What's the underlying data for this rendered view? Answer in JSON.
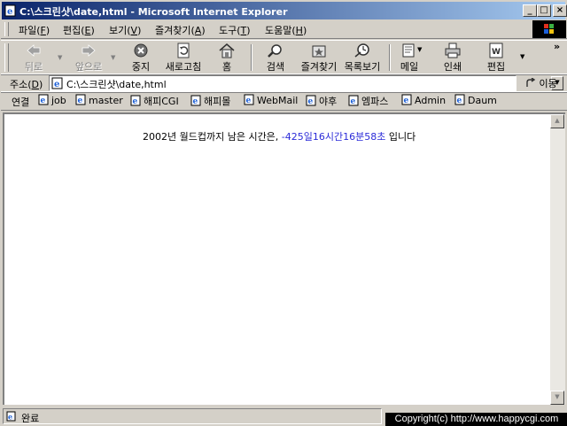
{
  "window": {
    "title": "C:\\스크린샷\\date,html - Microsoft Internet Explorer"
  },
  "menu": [
    {
      "label": "파일(",
      "key": "F",
      "end": ")"
    },
    {
      "label": "편집(",
      "key": "E",
      "end": ")"
    },
    {
      "label": "보기(",
      "key": "V",
      "end": ")"
    },
    {
      "label": "즐겨찾기(",
      "key": "A",
      "end": ")"
    },
    {
      "label": "도구(",
      "key": "T",
      "end": ")"
    },
    {
      "label": "도움말(",
      "key": "H",
      "end": ")"
    }
  ],
  "toolbar": {
    "back": "뒤로",
    "forward": "앞으로",
    "stop": "중지",
    "refresh": "새로고침",
    "home": "홈",
    "search": "검색",
    "favorites": "즐겨찾기",
    "history": "목록보기",
    "mail": "메일",
    "print": "인쇄",
    "edit": "편집"
  },
  "address": {
    "label_start": "주소(",
    "label_key": "D",
    "label_end": ")",
    "url": "C:\\스크린샷\\date,html",
    "go": "이동"
  },
  "links": {
    "label": "연결",
    "items": [
      "job",
      "master",
      "해피CGI",
      "해피몰",
      "WebMail",
      "야후",
      "엠파스",
      "Admin",
      "Daum"
    ]
  },
  "page": {
    "message_before": "2002년 월드컵까지 남은 시간은, ",
    "countdown": "-425일16시간16분58초",
    "message_after": " 입니다"
  },
  "status": {
    "text": "완료",
    "copyright": "Copyright(c) http://www.happycgi.com"
  },
  "colors": {
    "title_start": "#0a246a",
    "title_end": "#a6caf0",
    "countdown": "#2b2bd8",
    "chrome": "#d4d0c8"
  }
}
